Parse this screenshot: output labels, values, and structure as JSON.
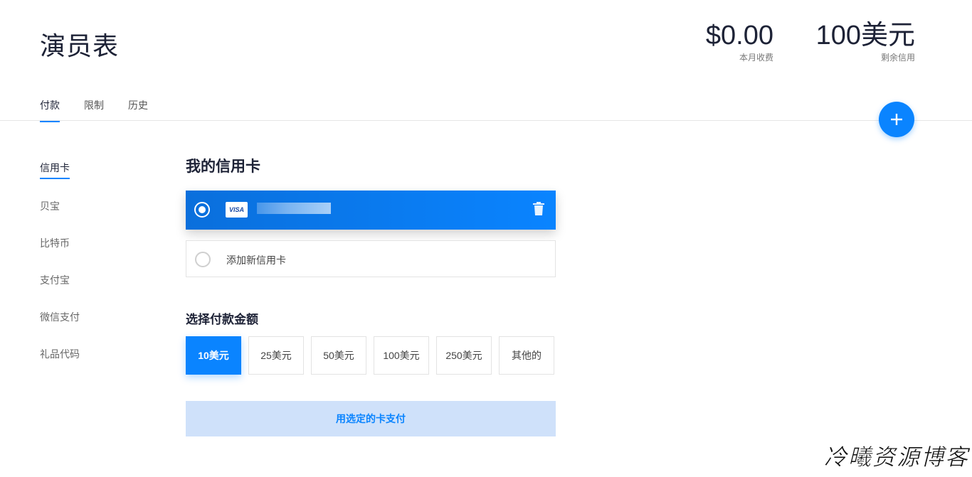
{
  "page": {
    "title": "演员表"
  },
  "stats": {
    "charges_value": "$0.00",
    "charges_label": "本月收费",
    "credit_value": "100美元",
    "credit_label": "剩余信用"
  },
  "tabs": [
    {
      "label": "付款",
      "active": true
    },
    {
      "label": "限制",
      "active": false
    },
    {
      "label": "历史",
      "active": false
    }
  ],
  "fab": {
    "icon": "plus-icon"
  },
  "sidebar": {
    "items": [
      {
        "label": "信用卡",
        "active": true
      },
      {
        "label": "贝宝",
        "active": false
      },
      {
        "label": "比特币",
        "active": false
      },
      {
        "label": "支付宝",
        "active": false
      },
      {
        "label": "微信支付",
        "active": false
      },
      {
        "label": "礼品代码",
        "active": false
      }
    ]
  },
  "cards": {
    "title": "我的信用卡",
    "saved_card": {
      "brand": "VISA",
      "selected": true,
      "delete_icon": "trash-icon"
    },
    "add_card_label": "添加新信用卡"
  },
  "amounts": {
    "title": "选择付款金额",
    "options": [
      "10美元",
      "25美元",
      "50美元",
      "100美元",
      "250美元",
      "其他的"
    ],
    "selected_index": 0
  },
  "pay_button": {
    "label": "用选定的卡支付"
  },
  "watermark": "冷曦资源博客",
  "colors": {
    "accent": "#0a84ff",
    "title": "#1d2236",
    "button_disabled_bg": "#cfe1fa"
  }
}
